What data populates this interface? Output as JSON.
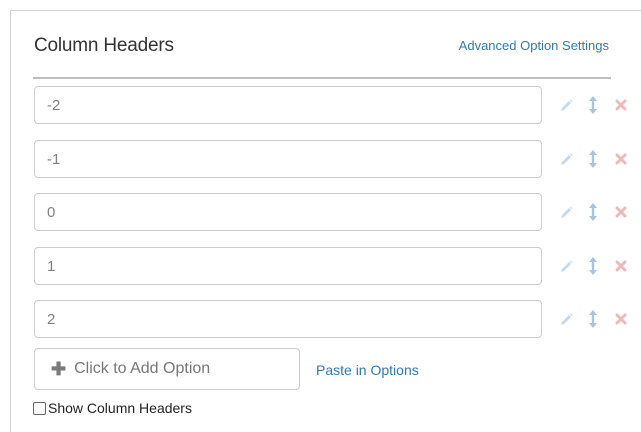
{
  "header": {
    "title": "Column Headers",
    "advanced_link": "Advanced Option Settings"
  },
  "options": [
    {
      "value": "-2"
    },
    {
      "value": "-1"
    },
    {
      "value": "0"
    },
    {
      "value": "1"
    },
    {
      "value": "2"
    }
  ],
  "row_icons": [
    "pencil-icon",
    "move-arrows-icon",
    "delete-x-icon"
  ],
  "add_option": {
    "label": "Click to Add Option",
    "icon": "plus-icon"
  },
  "paste_link": "Paste in Options",
  "show_headers": {
    "label": "Show Column Headers",
    "checked": false
  },
  "colors": {
    "link": "#2f7ab5",
    "edit_icon": "#c5d9ec",
    "move_icon": "#a9c3df",
    "delete_icon": "#f0b8b8",
    "border": "#cccccc"
  }
}
